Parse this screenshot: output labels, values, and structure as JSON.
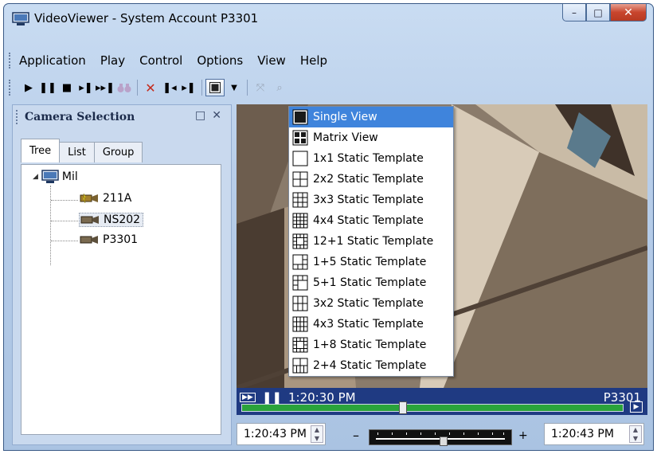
{
  "window": {
    "title": "VideoViewer - System Account P3301",
    "buttons": {
      "minimize": "–",
      "maximize": "□",
      "close": "✕"
    }
  },
  "menu": [
    "Application",
    "Play",
    "Control",
    "Options",
    "View",
    "Help"
  ],
  "toolbar": {
    "icons": [
      "play-icon",
      "pause-icon",
      "stop-icon",
      "step-forward-icon",
      "skip-end-icon",
      "binoculars-icon",
      "delete-icon",
      "prev-marker-icon",
      "next-marker-icon",
      "view-layout-icon",
      "dropdown-arrow-icon",
      "zoom-icon",
      "search-icon"
    ]
  },
  "camera_panel": {
    "title": "Camera Selection",
    "tabs": [
      "Tree",
      "List",
      "Group"
    ],
    "active_tab": "Tree",
    "tree": {
      "root": "Mil",
      "cameras": [
        "211A",
        "NS202",
        "P3301"
      ],
      "selected": "NS202"
    }
  },
  "view_menu": {
    "items": [
      {
        "label": "Single View",
        "icon": "single-view-icon",
        "selected": true
      },
      {
        "label": "Matrix View",
        "icon": "matrix-view-icon"
      },
      {
        "label": "1x1 Static Template",
        "icon": "grid-1x1-icon"
      },
      {
        "label": "2x2 Static Template",
        "icon": "grid-2x2-icon"
      },
      {
        "label": "3x3 Static Template",
        "icon": "grid-3x3-icon"
      },
      {
        "label": "4x4 Static Template",
        "icon": "grid-4x4-icon"
      },
      {
        "label": "12+1 Static Template",
        "icon": "grid-12-1-icon"
      },
      {
        "label": "1+5 Static Template",
        "icon": "grid-1-5-icon"
      },
      {
        "label": "5+1 Static Template",
        "icon": "grid-5-1-icon"
      },
      {
        "label": "3x2 Static Template",
        "icon": "grid-3x2-icon"
      },
      {
        "label": "4x3 Static Template",
        "icon": "grid-4x3-icon"
      },
      {
        "label": "1+8 Static Template",
        "icon": "grid-1-8-icon"
      },
      {
        "label": "2+4 Static Template",
        "icon": "grid-2-4-icon"
      }
    ]
  },
  "video": {
    "time": "1:20:30 PM",
    "camera": "P3301",
    "progress": 0.42
  },
  "controls": {
    "start_time": "1:20:43 PM",
    "end_time": "1:20:43 PM",
    "minus": "–",
    "plus": "+",
    "speed_position": 0.5
  },
  "colors": {
    "accent": "#3f84dc",
    "status_bar": "#1f3a82",
    "progress": "#2aa33b"
  }
}
